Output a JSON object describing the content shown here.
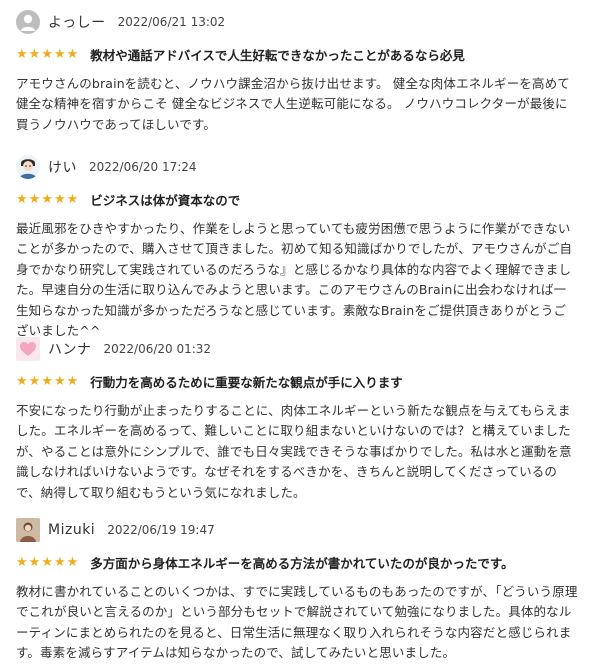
{
  "reviews": [
    {
      "user": "よっしー",
      "date": "2022/06/21 13:02",
      "stars": 5,
      "title": "教材や通話アドバイスで人生好転できなかったことがあるなら必見",
      "body": "アモウさんのbrainを読むと、ノウハウ課金沼から抜け出せます。 健全な肉体エネルギーを高めて 健全な精神を宿すからこそ 健全なビジネスで人生逆転可能になる。 ノウハウコレクターが最後に買うノウハウであってほしいです。",
      "avatar": "default-user-icon"
    },
    {
      "user": "けい",
      "date": "2022/06/20 17:24",
      "stars": 5,
      "title": "ビジネスは体が資本なので",
      "body": "最近風邪をひきやすかったり、作業をしようと思っていても疲労困憊で思うように作業ができないことが多かったので、購入させて頂きました。初めて知る知識ばかりでしたが、アモウさんがご自身でかなり研究して実践されているのだろうな』と感じるかなり具体的な内容でよく理解できました。早速自分の生活に取り込んでみようと思います。このアモウさんのBrainに出会わなければ一生知らなかった知識が多かっただろうなと感じています。素敵なBrainをご提供頂きありがとうございました^^",
      "avatar": "illustrated-person-icon"
    },
    {
      "user": "ハンナ",
      "date": "2022/06/20 01:32",
      "stars": 5,
      "title": "行動力を高めるために重要な新たな観点が手に入ります",
      "body": "不安になったり行動が止まったりすることに、肉体エネルギーという新たな観点を与えてもらえました。エネルギーを高めるって、難しいことに取り組まないといけないのでは？と構えていましたが、やることは意外にシンプルで、誰でも日々実践できそうな事ばかりでした。私は水と運動を意識しなければいけないようです。なぜそれをするべきかを、きちんと説明してくださっているので、納得して取り組むもうという気になれました。",
      "avatar": "pink-heart-icon"
    },
    {
      "user": "Mizuki",
      "date": "2022/06/19 19:47",
      "stars": 5,
      "title": "多方面から身体エネルギーを高める方法が書かれていたのが良かったです。",
      "body": "教材に書かれていることのいくつかは、すでに実践しているものもあったのですが、「どういう原理でこれが良いと言えるのか」という部分もセットで解説されていて勉強になりました。具体的なルーティンにまとめられたのを見ると、日常生活に無理なく取り入れられそうな内容だと感じられます。毒素を減らすアイテムは知らなかったので、試してみたいと思いました。",
      "avatar": "photo-avatar-icon"
    }
  ],
  "colors": {
    "star": "#f0ad1b",
    "text": "#333333",
    "title": "#222222"
  }
}
